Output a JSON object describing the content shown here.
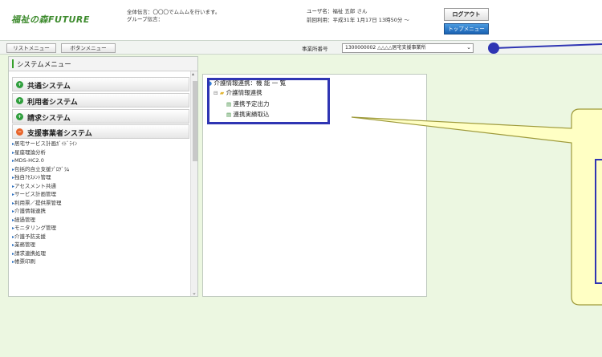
{
  "header": {
    "logo_text": "福祉の森FUTURE",
    "notice_line1": "全体伝言：〇〇〇でムムムを行います。",
    "notice_line2": "グループ伝言：",
    "user_line": "ユーザ名：福祉 五郎 さん",
    "usage_line": "前回利用：平成31年 1月17日 13時50分 ～",
    "logout_label": "ログアウト",
    "top_menu_label": "トップメニュー"
  },
  "toolbar": {
    "list_menu_label": "リストメニュー",
    "button_menu_label": "ボタンメニュー",
    "office_label": "事業所番号",
    "office_value": "1300000002 △△△△居宅支援事業所"
  },
  "system_menu": {
    "title": "システムメニュー",
    "systems": [
      {
        "label": "共通システム",
        "icon": "plus-circle-icon",
        "color": "#2e9e3c"
      },
      {
        "label": "利用者システム",
        "icon": "plus-circle-icon",
        "color": "#2e9e3c"
      },
      {
        "label": "請求システム",
        "icon": "plus-circle-icon",
        "color": "#2e9e3c"
      },
      {
        "label": "支援事業者システム",
        "icon": "minus-circle-icon",
        "color": "#e8642a"
      }
    ],
    "sub_items": [
      "居宅サービス計画ｶﾞｲﾄﾞﾗｲﾝ",
      "星座理論分析",
      "MDS-HC2.0",
      "包括的自立支援ﾌﾟﾛｸﾞﾗﾑ",
      "独自ｱｾｽﾒﾝﾄ管理",
      "アセスメント共通",
      "サービス計画管理",
      "利用票／提供票管理",
      "介護情報連携",
      "経過管理",
      "モニタリング管理",
      "介護予防支援",
      "業務管理",
      "請求連携処理",
      "帳票印刷"
    ]
  },
  "tree": {
    "root_label": "介護情報連携：機 能 一 覧",
    "folder_label": "介護情報連携",
    "leaves": [
      "連携予定出力",
      "連携実績取込"
    ]
  },
  "colors": {
    "page_background": "#ecf7e1",
    "highlight_border": "#2f35b3",
    "callout_fill": "#ffffc4",
    "callout_border": "#9e9a3b"
  }
}
